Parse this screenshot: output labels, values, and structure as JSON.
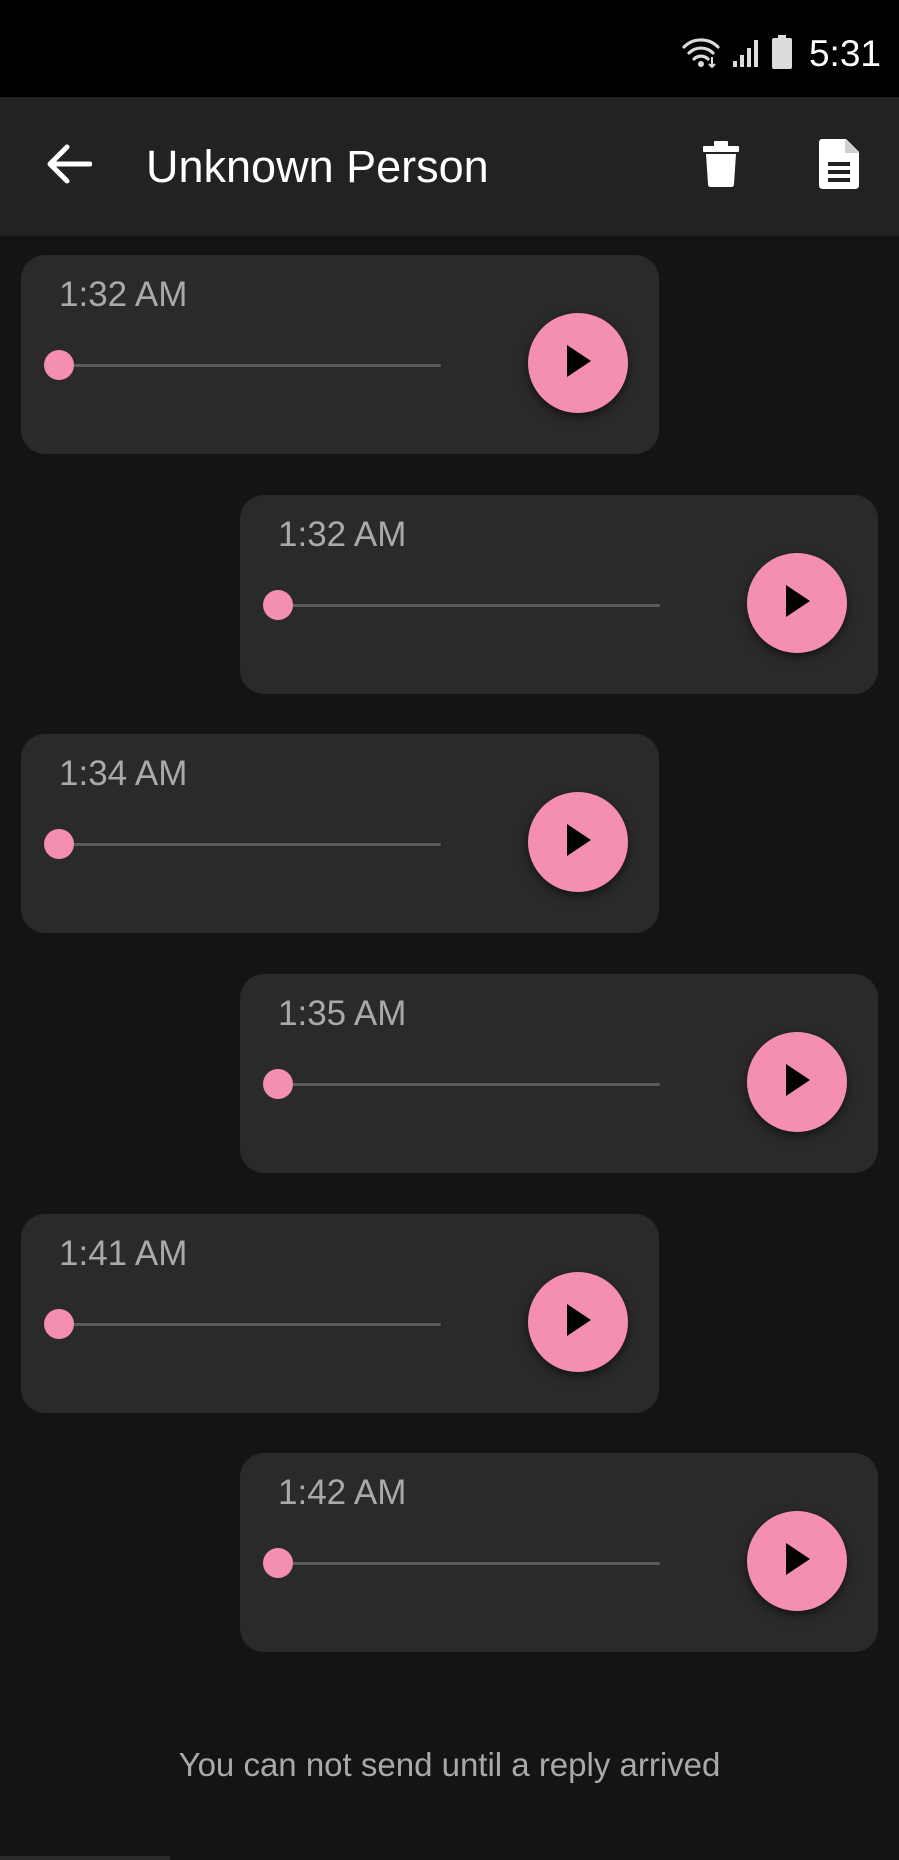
{
  "status_bar": {
    "time": "5:31",
    "icons": [
      "wifi-icon",
      "signal-icon",
      "battery-icon"
    ]
  },
  "app_bar": {
    "title": "Unknown Person",
    "back_icon": "arrow-back-icon",
    "actions": [
      "delete-icon",
      "document-icon"
    ]
  },
  "messages": [
    {
      "time": "1:32 AM",
      "side": "left",
      "progress": 0
    },
    {
      "time": "1:32 AM",
      "side": "right",
      "progress": 0
    },
    {
      "time": "1:34 AM",
      "side": "left",
      "progress": 0
    },
    {
      "time": "1:35 AM",
      "side": "right",
      "progress": 0
    },
    {
      "time": "1:41 AM",
      "side": "left",
      "progress": 0
    },
    {
      "time": "1:42 AM",
      "side": "right",
      "progress": 0
    }
  ],
  "footer_note": "You can not send until a reply arrived",
  "colors": {
    "accent": "#f48fb1",
    "app_bar": "#222222",
    "background": "#141414",
    "bubble": "#2a2a2a",
    "muted_text": "#a9a9a9"
  }
}
